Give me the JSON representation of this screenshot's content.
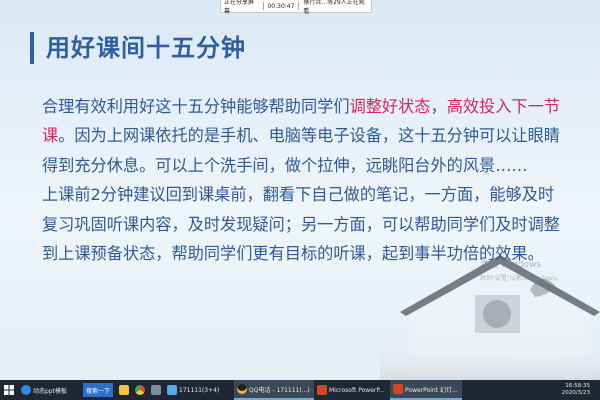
{
  "share_bar": {
    "sharing_label": "正在分享屏幕",
    "timer": "00:30:47",
    "viewers": "蔡行兵...等29人正在观看"
  },
  "slide": {
    "title": "用好课间十五分钟",
    "paragraph1": {
      "part1": "合理有效利用好这十五分钟能够帮助同学们",
      "highlight1": "调整好状态",
      "sep": "，",
      "highlight2": "高效投入下一节课",
      "part2": "。因为上网课依托的是手机、电脑等电子设备，这十五分钟可以让眼睛得到充分休息。可以上个洗手间，做个拉伸，远眺阳台外的风景……"
    },
    "paragraph2": "上课前2分钟建议回到课桌前，翻看下自己做的笔记，一方面，能够及时复习巩固听课内容，及时发现疑问；另一方面，可以帮助同学们及时调整到上课预备状态，帮助同学们更有目标的听课，起到事半功倍的效果。",
    "watermark_line1": "激活 Windows",
    "watermark_line2": "转到\"设置\"以激活 Windows。"
  },
  "taskbar": {
    "items": [
      {
        "label": "动态ppt模板"
      },
      {
        "label": "搜索一下"
      },
      {
        "label": "171111(3+4)"
      },
      {
        "label": "QQ电话 - 171111(...)"
      },
      {
        "label": "Microsoft PowerP..."
      },
      {
        "label": "PowerPoint 幻灯..."
      }
    ],
    "time": "16:58:35",
    "date": "2020/3/23"
  },
  "colors": {
    "title": "#2f5f9f",
    "body": "#2f5a95",
    "highlight": "#d5265a",
    "taskbar": "#1e2733"
  }
}
